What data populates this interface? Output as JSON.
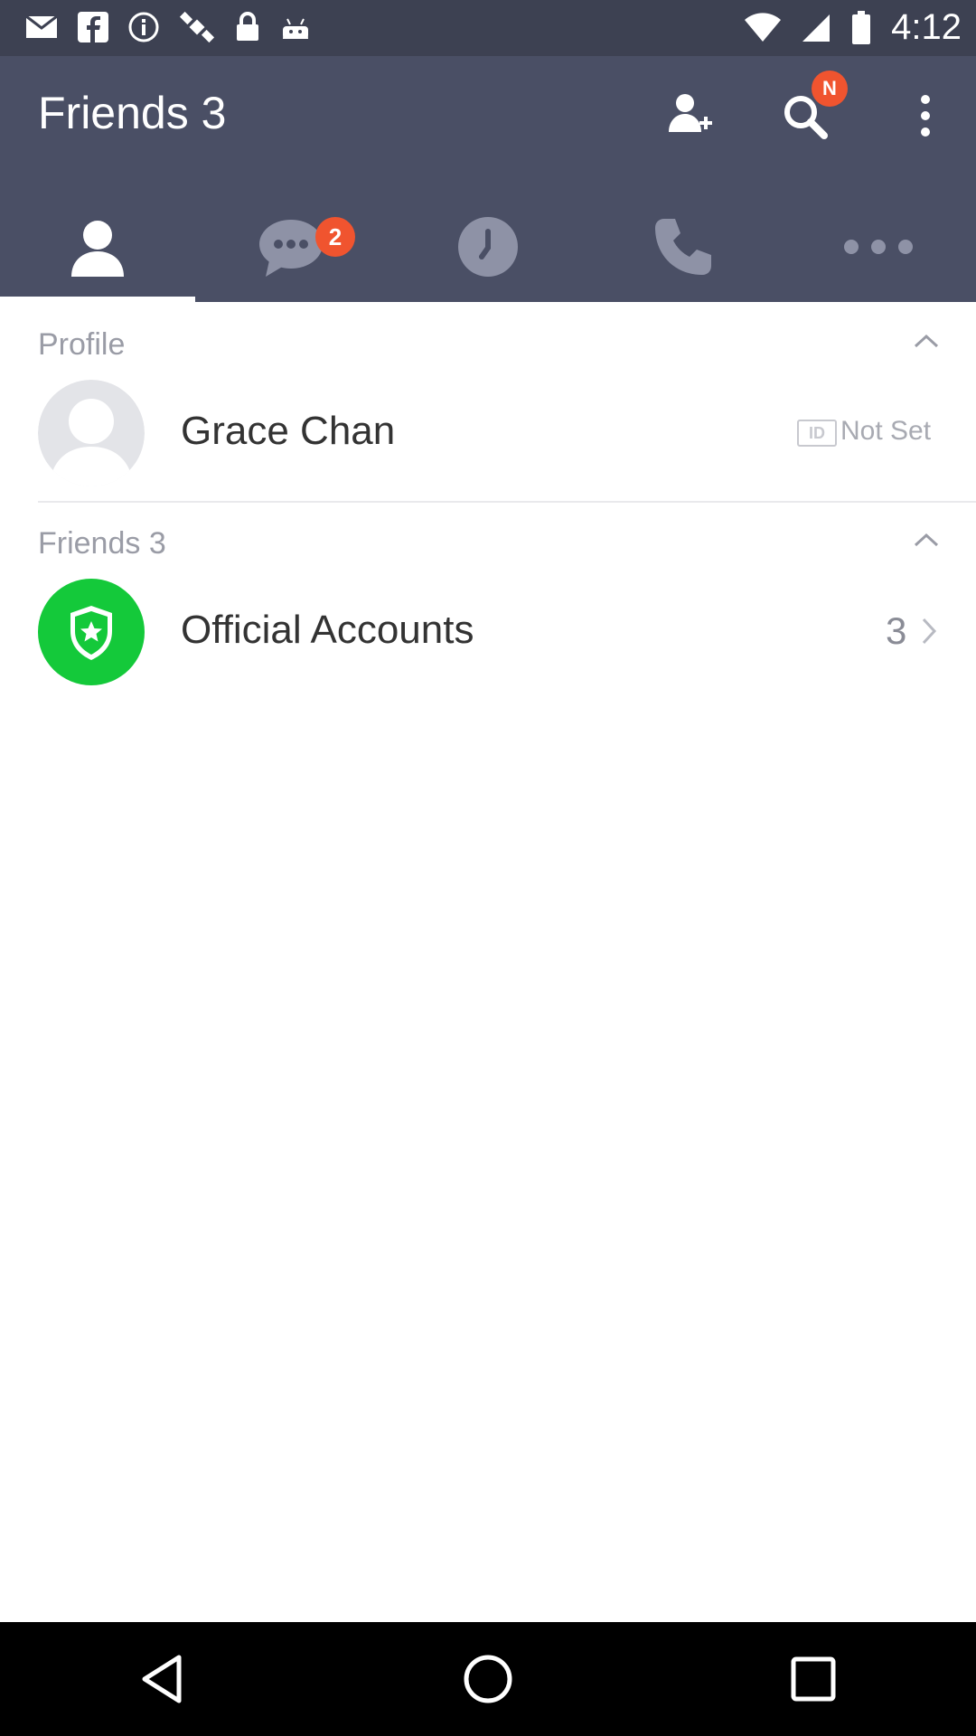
{
  "status_bar": {
    "time": "4:12",
    "icons": [
      "mail-icon",
      "facebook-icon",
      "info-icon",
      "satellite-icon",
      "lock-icon",
      "android-icon",
      "wifi-icon",
      "signal-icon",
      "battery-icon"
    ]
  },
  "header": {
    "title": "Friends 3",
    "search_badge": "N",
    "actions": [
      "add-friend-icon",
      "search-icon",
      "overflow-menu-icon"
    ]
  },
  "tabs": [
    {
      "icon": "person-icon",
      "active": true
    },
    {
      "icon": "chat-icon",
      "badge": "2"
    },
    {
      "icon": "clock-icon"
    },
    {
      "icon": "phone-icon"
    },
    {
      "icon": "more-icon"
    }
  ],
  "profile": {
    "section_label": "Profile",
    "name": "Grace Chan",
    "id_badge": "ID",
    "id_value": "Not Set"
  },
  "friends": {
    "section_label": "Friends 3",
    "official_accounts_label": "Official Accounts",
    "official_accounts_count": "3"
  },
  "colors": {
    "header_bg": "#4a4f65",
    "status_bg": "#3d4152",
    "badge": "#f0542f",
    "official_green": "#14c93a",
    "muted_text": "#9a9ca6"
  }
}
